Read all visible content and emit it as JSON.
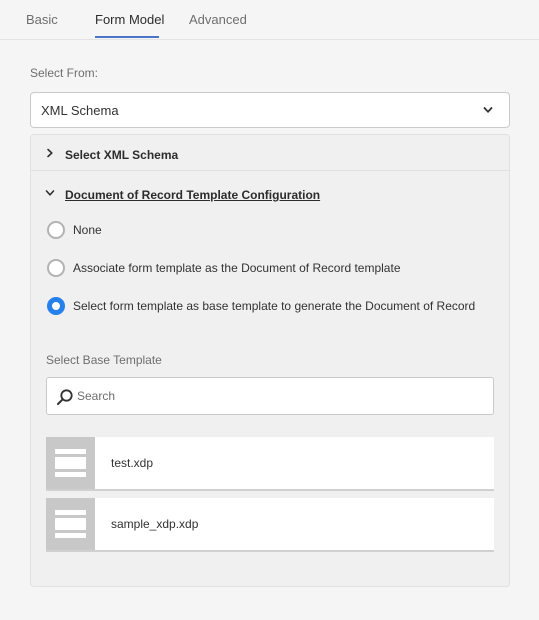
{
  "tabs": [
    {
      "label": "Basic",
      "active": false
    },
    {
      "label": "Form Model",
      "active": true
    },
    {
      "label": "Advanced",
      "active": false
    }
  ],
  "select_from": {
    "label": "Select From:",
    "value": "XML Schema"
  },
  "sections": {
    "xml_schema": {
      "title": "Select XML Schema",
      "expanded": false
    },
    "dor": {
      "title": "Document of Record Template Configuration",
      "expanded": true
    }
  },
  "dor_options": [
    {
      "label": "None",
      "checked": false
    },
    {
      "label": "Associate form template as the Document of Record template",
      "checked": false
    },
    {
      "label": "Select form template as base template to generate the Document of Record",
      "checked": true
    }
  ],
  "base_template": {
    "label": "Select Base Template",
    "search_placeholder": "Search",
    "files": [
      {
        "name": "test.xdp"
      },
      {
        "name": "sample_xdp.xdp"
      }
    ]
  },
  "colors": {
    "accent": "#2680eb",
    "tab_indicator": "#4b75c7",
    "thumb": "#c8c8c8"
  }
}
